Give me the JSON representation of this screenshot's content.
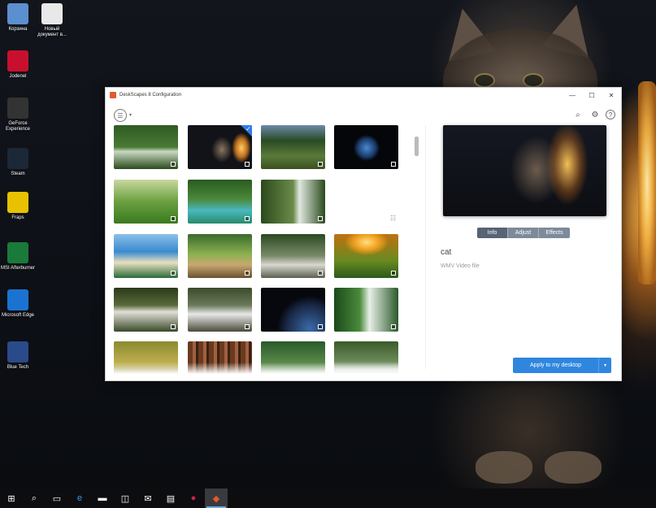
{
  "desktop": {
    "icons": [
      {
        "label": "Корзина",
        "icon": "recycle-bin-icon",
        "color": "#5b8fd0"
      },
      {
        "label": "Новый документ в...",
        "icon": "text-document-icon",
        "color": "#e8e8e8"
      },
      {
        "label": "Jodenel",
        "icon": "red-circle-app-icon",
        "color": "#c8102e"
      },
      {
        "label": "GeForce Experience",
        "icon": "geforce-icon",
        "color": "#333"
      },
      {
        "label": "Steam",
        "icon": "steam-icon",
        "color": "#1b2838"
      },
      {
        "label": "Fraps",
        "icon": "fraps-icon",
        "color": "#e8c100"
      },
      {
        "label": "MSI Afterburner",
        "icon": "msi-afterburner-icon",
        "color": "#1a7a3a"
      },
      {
        "label": "Microsoft Edge",
        "icon": "edge-icon",
        "color": "#1a73d0"
      },
      {
        "label": "Blue Tech",
        "icon": "blue-tech-icon",
        "color": "#2a4a8a"
      }
    ]
  },
  "window": {
    "title": "DeskScapes 8 Configuration",
    "controls": {
      "minimize": "—",
      "maximize": "☐",
      "close": "✕"
    }
  },
  "toolbar": {
    "settings_glyph": "☰",
    "caret": "▾",
    "search_glyph": "⌕",
    "gear_glyph": "⚙",
    "help_glyph": "?"
  },
  "gallery": {
    "list_view_glyph": "☷",
    "thumbnails": [
      {
        "theme": "forest-waterfall",
        "selected": false
      },
      {
        "theme": "cat-lamp",
        "selected": true
      },
      {
        "theme": "jungle-river",
        "selected": false
      },
      {
        "theme": "earth-space",
        "selected": false
      },
      {
        "theme": "sunny-meadow",
        "selected": false
      },
      {
        "theme": "tropical-lagoon",
        "selected": false
      },
      {
        "theme": "forest-falls",
        "selected": false
      },
      {
        "theme": "coastal-bay",
        "selected": false
      },
      {
        "theme": "forest-stream",
        "selected": false
      },
      {
        "theme": "rocky-creek",
        "selected": false
      },
      {
        "theme": "sunset-falls",
        "selected": false
      },
      {
        "theme": "mossy-cascade",
        "selected": false
      },
      {
        "theme": "rocky-rapids",
        "selected": false
      },
      {
        "theme": "planet-space",
        "selected": false
      },
      {
        "theme": "green-waterfall",
        "selected": false
      },
      {
        "theme": "golden-forest",
        "selected": false
      },
      {
        "theme": "redwood-trees",
        "selected": false
      },
      {
        "theme": "river-bend",
        "selected": false
      },
      {
        "theme": "stream-rocks",
        "selected": false
      }
    ],
    "check_glyph": "✓"
  },
  "details": {
    "tabs": [
      {
        "label": "Info",
        "selected": true
      },
      {
        "label": "Adjust",
        "selected": false
      },
      {
        "label": "Effects",
        "selected": false
      }
    ],
    "name": "cat",
    "type": "WMV Video file"
  },
  "apply_button": {
    "label": "Apply to my desktop",
    "dropdown_glyph": "▾"
  },
  "taskbar": {
    "items": [
      {
        "glyph": "⊞",
        "icon": "windows-start-icon",
        "active": false
      },
      {
        "glyph": "⌕",
        "icon": "search-icon",
        "active": false
      },
      {
        "glyph": "▭",
        "icon": "task-view-icon",
        "active": false
      },
      {
        "glyph": "e",
        "icon": "edge-icon",
        "active": false
      },
      {
        "glyph": "▬",
        "icon": "file-explorer-icon",
        "active": false
      },
      {
        "glyph": "◫",
        "icon": "store-icon",
        "active": false
      },
      {
        "glyph": "✉",
        "icon": "mail-icon",
        "active": false
      },
      {
        "glyph": "▤",
        "icon": "app-window-icon",
        "active": false
      },
      {
        "glyph": "●",
        "icon": "red-app-icon",
        "active": false
      },
      {
        "glyph": "◆",
        "icon": "deskscapes-icon",
        "active": true
      }
    ]
  },
  "colors": {
    "accent": "#2f86de",
    "tab_selected": "#566475",
    "tab_normal": "#7d8a99"
  }
}
